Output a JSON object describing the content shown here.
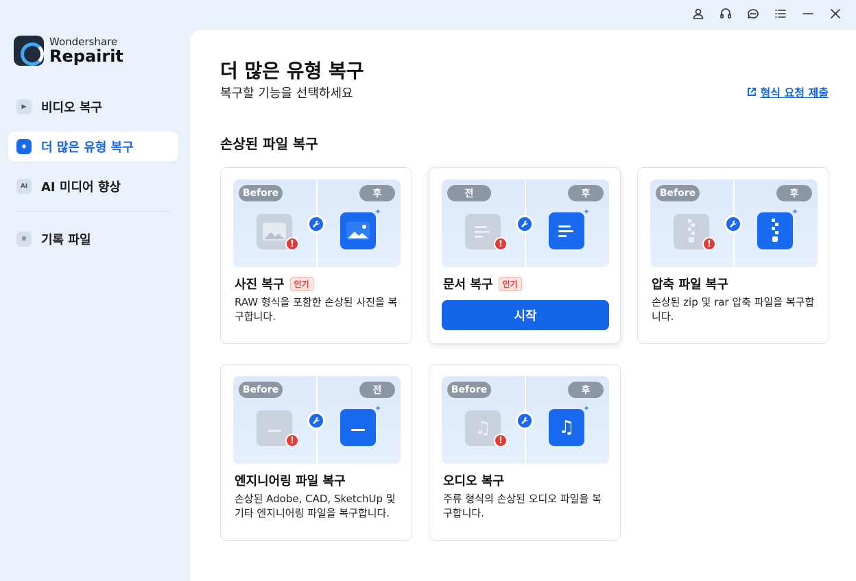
{
  "app": {
    "brand_top": "Wondershare",
    "brand_name": "Repairit"
  },
  "topbar": {
    "icons": [
      "account-icon",
      "support-headset-icon",
      "chat-icon",
      "menu-list-icon",
      "minimize-icon",
      "close-icon"
    ]
  },
  "sidebar": {
    "items": [
      {
        "label": "비디오 복구",
        "icon": "video-icon",
        "active": false
      },
      {
        "label": "더 많은 유형 복구",
        "icon": "more-types-icon",
        "active": true
      },
      {
        "label": "AI 미디어 향상",
        "icon": "ai-icon",
        "icon_text": "AI",
        "active": false
      },
      {
        "label": "기록 파일",
        "icon": "history-icon",
        "active": false
      }
    ]
  },
  "main": {
    "title": "더 많은 유형 복구",
    "subtitle": "복구할 기능을 선택하세요",
    "request_link": "형식 요청 제출",
    "section_title": "손상된 파일 복구",
    "cards": [
      {
        "title": "사진 복구",
        "badge": "인기",
        "desc": "RAW 형식을 포함한 손상된 사진을 복구합니다.",
        "before_label": "Before",
        "after_label": "후",
        "icon": "image-icon"
      },
      {
        "title": "문서 복구",
        "badge": "인기",
        "button": "시작",
        "before_label": "전",
        "after_label": "후",
        "icon": "document-icon"
      },
      {
        "title": "압축 파일 복구",
        "desc": "손상된 zip 및 rar 압축 파일을 복구합니다.",
        "before_label": "Before",
        "after_label": "후",
        "icon": "archive-icon"
      },
      {
        "title": "엔지니어링 파일 복구",
        "desc": "손상된 Adobe, CAD, SketchUp 및 기타 엔지니어링 파일을 복구합니다.",
        "before_label": "Before",
        "after_label": "전",
        "icon": "folder-icon"
      },
      {
        "title": "오디오 복구",
        "desc": "주류 형식의 손상된 오디오 파일을 복구합니다.",
        "before_label": "Before",
        "after_label": "후",
        "icon": "audio-icon"
      }
    ]
  },
  "colors": {
    "accent": "#1565e8",
    "sidebar_bg": "#e9f1fb",
    "badge_red": "#e53935"
  }
}
